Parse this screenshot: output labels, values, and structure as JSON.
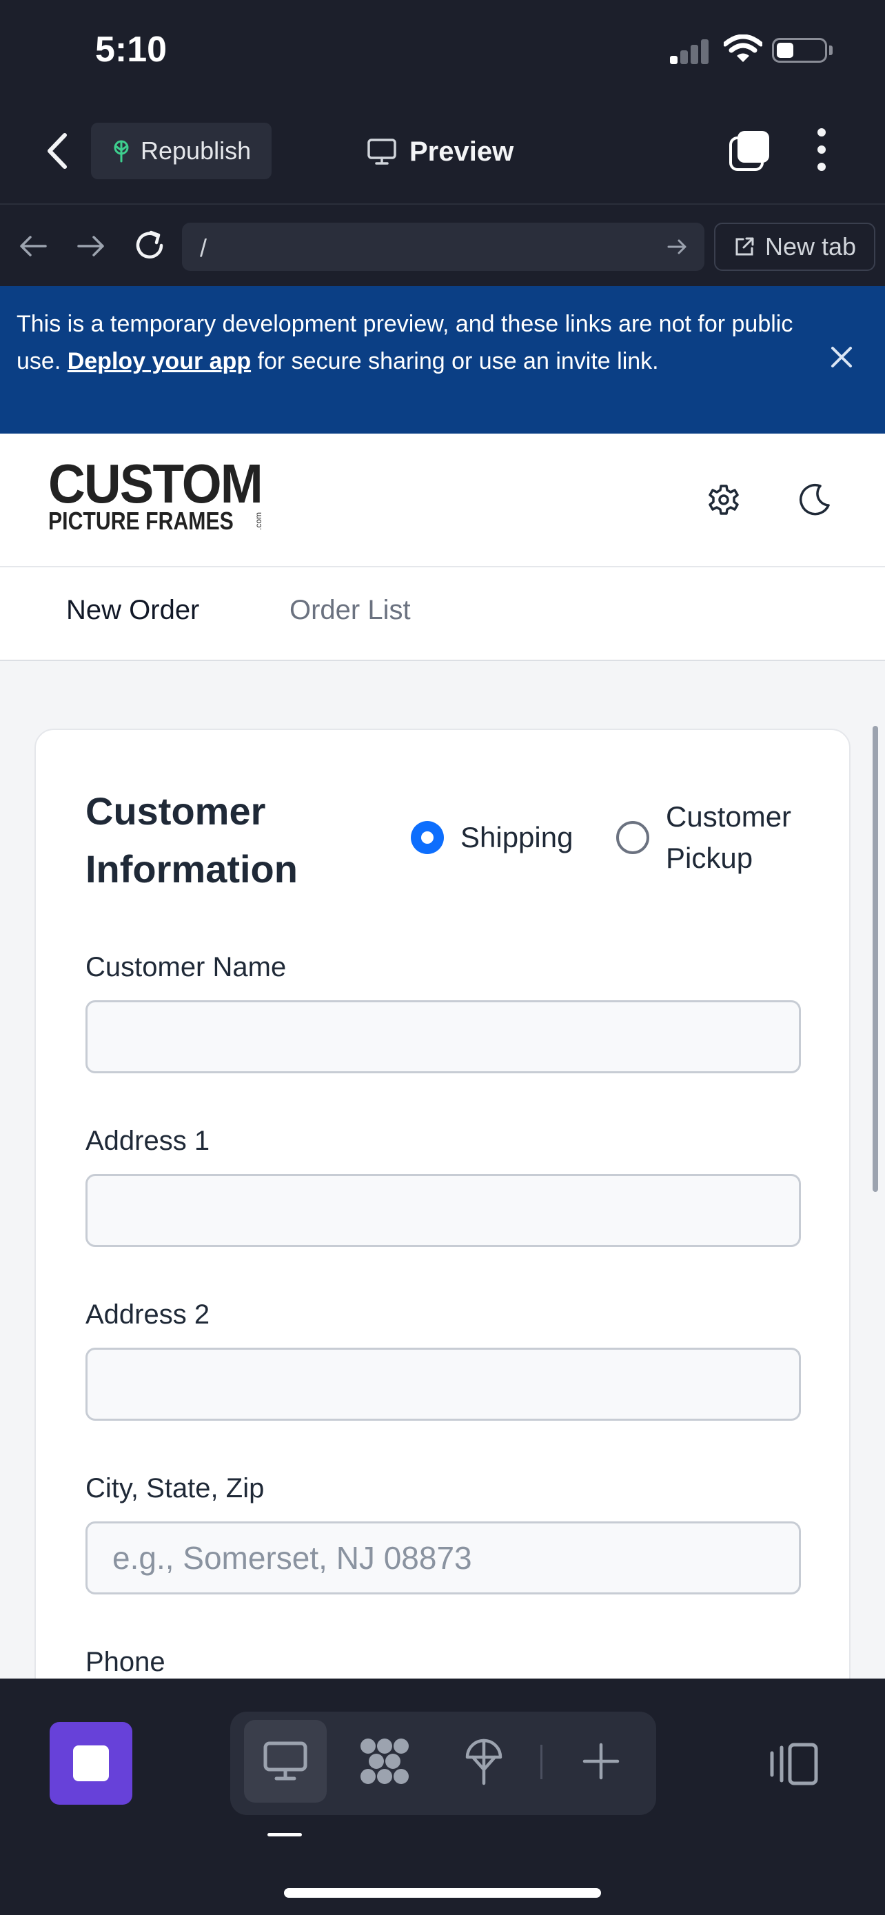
{
  "status_bar": {
    "time": "5:10"
  },
  "app_header": {
    "republish_label": "Republish",
    "preview_label": "Preview"
  },
  "url_bar": {
    "url": "/",
    "new_tab_label": "New tab"
  },
  "banner": {
    "text_before": "This is a temporary development preview, and these links are not for public use. ",
    "link_text": "Deploy your app",
    "text_after": " for secure sharing or use an invite link."
  },
  "site": {
    "logo_line1": "CUSTOM",
    "logo_line2": "PICTURE FRAMES",
    "logo_suffix": ".com"
  },
  "nav": {
    "tab_new_order": "New Order",
    "tab_order_list": "Order List"
  },
  "form": {
    "title": "Customer Information",
    "delivery_options": [
      {
        "label": "Shipping",
        "checked": true
      },
      {
        "label": "Customer Pickup",
        "checked": false
      }
    ],
    "fields": {
      "customer_name": {
        "label": "Customer Name",
        "value": "",
        "placeholder": ""
      },
      "address1": {
        "label": "Address 1",
        "value": "",
        "placeholder": ""
      },
      "address2": {
        "label": "Address 2",
        "value": "",
        "placeholder": ""
      },
      "city_state_zip": {
        "label": "City, State, Zip",
        "value": "",
        "placeholder": "e.g., Somerset, NJ 08873"
      },
      "phone": {
        "label": "Phone"
      }
    }
  },
  "colors": {
    "banner_bg": "#0b3f85",
    "radio_accent": "#0d6efd",
    "stop_button": "#6741d9",
    "republish_icon": "#3ecf8e"
  },
  "icons": [
    "back-icon",
    "republish-icon",
    "monitor-icon",
    "tabs-icon",
    "more-icon",
    "arrow-left-icon",
    "arrow-right-icon",
    "reload-icon",
    "external-link-icon",
    "close-icon",
    "gear-icon",
    "moon-icon",
    "stop-icon",
    "webview-icon",
    "grid-icon",
    "deploy-icon",
    "plus-icon",
    "panel-icon"
  ]
}
